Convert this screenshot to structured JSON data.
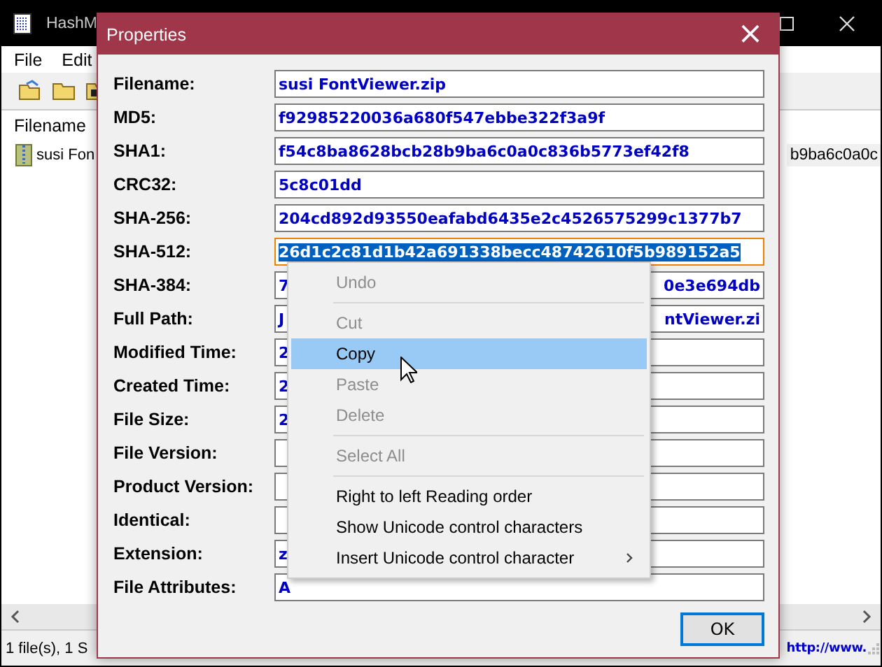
{
  "main_window": {
    "title": "HashM",
    "menu": [
      "File",
      "Edit"
    ],
    "list": {
      "columns": [
        "Filename"
      ],
      "rows": [
        {
          "filename": "susi Fon",
          "hash_tail": "b9ba6c0a0c"
        }
      ]
    },
    "status_bar": {
      "text": "1 file(s), 1 S",
      "link": "http://www."
    }
  },
  "dialog": {
    "title": "Properties",
    "close": "×",
    "fields": [
      {
        "label": "Filename:",
        "value": "susi FontViewer.zip",
        "highlighted": false
      },
      {
        "label": "MD5:",
        "value": "f92985220036a680f547ebbe322f3a9f",
        "highlighted": false
      },
      {
        "label": "SHA1:",
        "value": "f54c8ba8628bcb28b9ba6c0a0c836b5773ef42f8",
        "highlighted": false
      },
      {
        "label": "CRC32:",
        "value": "5c8c01dd",
        "highlighted": false
      },
      {
        "label": "SHA-256:",
        "value": "204cd892d93550eafabd6435e2c4526575299c1377b7",
        "highlighted": false
      },
      {
        "label": "SHA-512:",
        "value": "26d1c2c81d1b42a691338becc48742610f5b989152a5",
        "highlighted": true
      },
      {
        "label": "SHA-384:",
        "value": "7",
        "value_end": "0e3e694db",
        "highlighted": false
      },
      {
        "label": "Full Path:",
        "value": "J",
        "value_end": "ntViewer.zi",
        "highlighted": false
      },
      {
        "label": "Modified Time:",
        "value": "2",
        "highlighted": false
      },
      {
        "label": "Created Time:",
        "value": "2",
        "highlighted": false
      },
      {
        "label": "File Size:",
        "value": "2",
        "highlighted": false
      },
      {
        "label": "File Version:",
        "highlighted": false
      },
      {
        "label": "Product Version:",
        "highlighted": false
      },
      {
        "label": "Identical:",
        "highlighted": false
      },
      {
        "label": "Extension:",
        "value": "z",
        "highlighted": false
      },
      {
        "label": "File Attributes:",
        "value": "A",
        "highlighted": false
      }
    ],
    "ok_button": "OK"
  },
  "context_menu": [
    {
      "kind": "item",
      "label": "Undo",
      "disabled": true,
      "selected": false
    },
    {
      "kind": "separator"
    },
    {
      "kind": "item",
      "label": "Cut",
      "disabled": true,
      "selected": false
    },
    {
      "kind": "item",
      "label": "Copy",
      "disabled": false,
      "selected": true
    },
    {
      "kind": "item",
      "label": "Paste",
      "disabled": true,
      "selected": false
    },
    {
      "kind": "item",
      "label": "Delete",
      "disabled": true,
      "selected": false
    },
    {
      "kind": "separator"
    },
    {
      "kind": "item",
      "label": "Select All",
      "disabled": true,
      "selected": false
    },
    {
      "kind": "separator"
    },
    {
      "kind": "item",
      "label": "Right to left Reading order",
      "disabled": false,
      "selected": false
    },
    {
      "kind": "item",
      "label": "Show Unicode control characters",
      "disabled": false,
      "selected": false
    },
    {
      "kind": "item",
      "label": "Insert Unicode control character",
      "disabled": false,
      "selected": false,
      "submenu": true
    }
  ]
}
